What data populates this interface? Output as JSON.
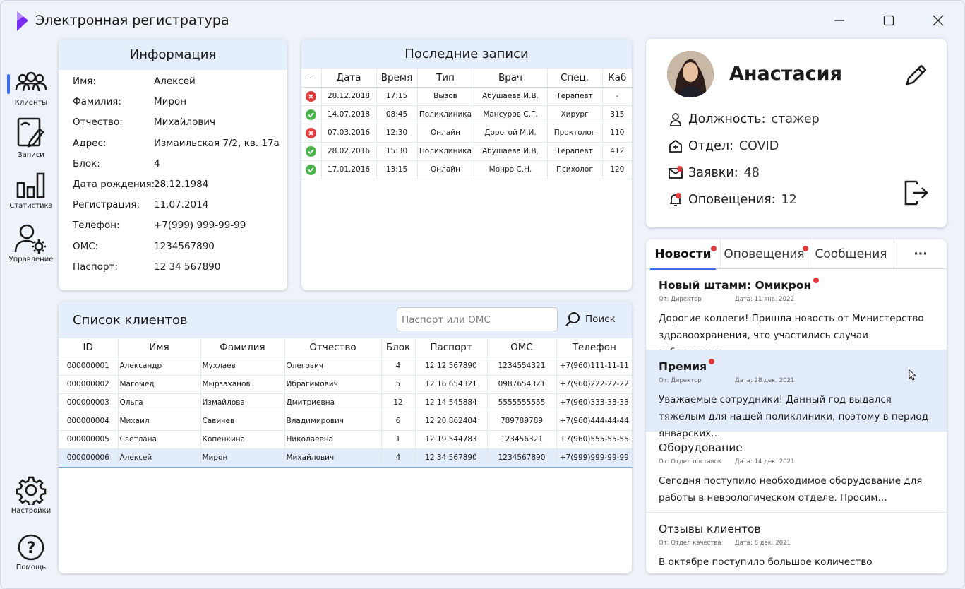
{
  "app": {
    "title": "Электронная регистратура",
    "accent": "#3b6ef5",
    "logo_color": "#7a2cf0"
  },
  "nav": {
    "items": [
      {
        "label": "Клиенты",
        "icon": "users-icon"
      },
      {
        "label": "Записи",
        "icon": "notebook-pen-icon"
      },
      {
        "label": "Статистика",
        "icon": "bar-chart-icon"
      },
      {
        "label": "Управление",
        "icon": "user-gear-icon"
      }
    ],
    "settings": "Настройки",
    "help": "Помощь"
  },
  "info": {
    "title": "Информация",
    "rows": [
      {
        "label": "Имя:",
        "value": "Алексей"
      },
      {
        "label": "Фамилия:",
        "value": "Мирон"
      },
      {
        "label": "Отчество:",
        "value": "Михайлович"
      },
      {
        "label": "Адрес:",
        "value": "Измаильская 7/2, кв. 17а"
      },
      {
        "label": "Блок:",
        "value": "4"
      },
      {
        "label": "Дата рождения:",
        "value": "28.12.1984"
      },
      {
        "label": "Регистрация:",
        "value": "11.07.2014"
      },
      {
        "label": "Телефон:",
        "value": "+7(999) 999-99-99"
      },
      {
        "label": "ОМС:",
        "value": "1234567890"
      },
      {
        "label": "Паспорт:",
        "value": "12 34 567890"
      }
    ]
  },
  "records": {
    "title": "Последние записи",
    "headers": [
      "-",
      "Дата",
      "Время",
      "Тип",
      "Врач",
      "Спец.",
      "Каб"
    ],
    "rows": [
      {
        "status": "cancelled",
        "date": "28.12.2018",
        "time": "17:15",
        "type": "Вызов",
        "doctor": "Абушаева И.В.",
        "spec": "Терапевт",
        "room": "-"
      },
      {
        "status": "done",
        "date": "14.07.2018",
        "time": "08:45",
        "type": "Поликлиника",
        "doctor": "Мансуров С.Г.",
        "spec": "Хирург",
        "room": "315"
      },
      {
        "status": "cancelled",
        "date": "07.03.2016",
        "time": "12:30",
        "type": "Онлайн",
        "doctor": "Дорогой М.И.",
        "spec": "Проктолог",
        "room": "110"
      },
      {
        "status": "done",
        "date": "28.02.2016",
        "time": "15:30",
        "type": "Поликлиника",
        "doctor": "Абушаева И.В.",
        "spec": "Терапевт",
        "room": "412"
      },
      {
        "status": "done",
        "date": "17.01.2016",
        "time": "13:15",
        "type": "Онлайн",
        "doctor": "Монро С.Н.",
        "spec": "Психолог",
        "room": "120"
      }
    ]
  },
  "clients": {
    "title": "Список клиентов",
    "search_placeholder": "Паспорт или ОМС",
    "search_label": "Поиск",
    "headers": [
      "ID",
      "Имя",
      "Фамилия",
      "Отчество",
      "Блок",
      "Паспорт",
      "ОМС",
      "Телефон"
    ],
    "rows": [
      [
        "000000001",
        "Александр",
        "Мухлаев",
        "Олегович",
        "4",
        "12 12 567890",
        "1234554321",
        "+7(960)111-11-11"
      ],
      [
        "000000002",
        "Магомед",
        "Мырзаханов",
        "Ибрагимович",
        "5",
        "12 16 654321",
        "0987654321",
        "+7(960)222-22-22"
      ],
      [
        "000000003",
        "Ольга",
        "Измайлова",
        "Дмитриевна",
        "12",
        "12 14 545884",
        "5555555555",
        "+7(960)333-33-33"
      ],
      [
        "000000004",
        "Михаил",
        "Савичев",
        "Владимирович",
        "6",
        "12 20 862404",
        "789789789",
        "+7(960)444-44-44"
      ],
      [
        "000000005",
        "Светлана",
        "Копенкина",
        "Николаевна",
        "1",
        "12 19 544783",
        "123456321",
        "+7(960)555-55-55"
      ],
      [
        "000000006",
        "Алексей",
        "Мирон",
        "Михайлович",
        "4",
        "12 34 567890",
        "1234567890",
        "+7(999)999-99-99"
      ]
    ],
    "selected_index": 5
  },
  "profile": {
    "name": "Анастасия",
    "position_label": "Должность:",
    "position": "стажер",
    "dept_label": "Отдел:",
    "dept": "COVID",
    "requests_label": "Заявки:",
    "requests": "48",
    "alerts_label": "Оповещения:",
    "alerts": "12"
  },
  "news": {
    "tabs": [
      "Новости",
      "Оповещения",
      "Сообщения"
    ],
    "more": "···",
    "items": [
      {
        "title": "Новый штамм: Омикрон",
        "from": "От: Директор",
        "date": "Дата: 11 янв. 2022",
        "text": "Дорогие коллеги! Пришла новость от Министерство здравоохранения, что участились случаи заболевания…",
        "unread": true
      },
      {
        "title": "Премия",
        "from": "От: Директор",
        "date": "Дата: 28 дек. 2021",
        "text": "Уважаемые сотрудники! Данный год выдался тяжелым для нашей поликлиники, поэтому в период январских…",
        "unread": true
      },
      {
        "title": "Оборудование",
        "from": "От: Отдел поставок",
        "date": "Дата: 14 дек. 2021",
        "text": "Сегодня поступило необходимое оборудование для работы в неврологическом отделе. Просим…",
        "unread": false
      },
      {
        "title": "Отзывы клиентов",
        "from": "От: Отдел качества",
        "date": "Дата: 8 дек. 2021",
        "text": "В октябре поступило большое количество",
        "unread": false
      }
    ]
  }
}
